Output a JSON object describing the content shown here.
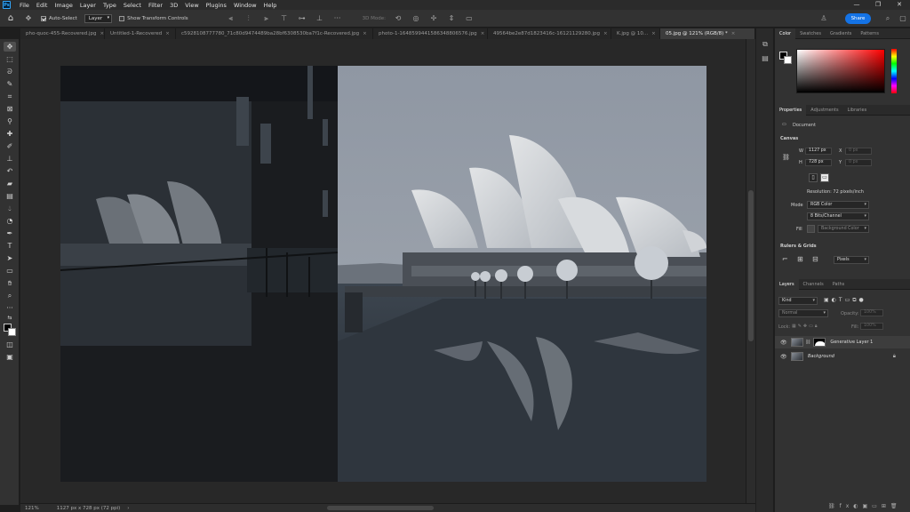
{
  "app": {
    "logo": "Ps",
    "window_controls": [
      "—",
      "❐",
      "✕"
    ]
  },
  "menu": [
    "File",
    "Edit",
    "Image",
    "Layer",
    "Type",
    "Select",
    "Filter",
    "3D",
    "View",
    "Plugins",
    "Window",
    "Help"
  ],
  "options_bar": {
    "auto_select_label": "Auto-Select",
    "auto_select_checked": true,
    "target_value": "Layer",
    "show_transform_label": "Show Transform Controls",
    "mode_3d_label": "3D Mode:",
    "share_label": "Share"
  },
  "tabs": [
    {
      "label": "pho-quoc-455-Recovered.jpg",
      "active": false
    },
    {
      "label": "Untitled-1-Recovered",
      "active": false
    },
    {
      "label": "c5928108777780_71c80d9474489ba28bf6308530ba7f1c-Recovered.jpg",
      "active": false
    },
    {
      "label": "photo-1-1648599441586348806576.jpg",
      "active": false
    },
    {
      "label": "49564be2e87d1823416c-16121129280.jpg",
      "active": false
    },
    {
      "label": "K.jpg @ 10...",
      "active": false
    },
    {
      "label": "05.jpg @ 121% (RGB/8) *",
      "active": true
    }
  ],
  "status": {
    "zoom": "121%",
    "doc_info": "1127 px x 728 px (72 ppi)"
  },
  "color_panel": {
    "tabs": [
      "Color",
      "Swatches",
      "Gradients",
      "Patterns"
    ],
    "active": "Color"
  },
  "properties_panel": {
    "tabs": [
      "Properties",
      "Adjustments",
      "Libraries"
    ],
    "active": "Properties",
    "doc_label": "Document",
    "canvas_title": "Canvas",
    "w_label": "W",
    "w_value": "1127 px",
    "h_label": "H",
    "h_value": "728 px",
    "x_label": "X",
    "x_value": "0 px",
    "y_label": "Y",
    "y_value": "0 px",
    "resolution": "Resolution: 72 pixels/inch",
    "mode_label": "Mode",
    "mode_value": "RGB Color",
    "depth_value": "8 Bits/Channel",
    "fill_label": "Fill",
    "fill_value": "Background Color",
    "rulers_title": "Rulers & Grids",
    "units_value": "Pixels"
  },
  "layers_panel": {
    "tabs": [
      "Layers",
      "Channels",
      "Paths"
    ],
    "active": "Layers",
    "kind_value": "Kind",
    "blend_value": "Normal",
    "opacity_label": "Opacity:",
    "opacity_value": "100%",
    "lock_label": "Lock:",
    "fill_label": "Fill:",
    "fill_value": "100%",
    "layers": [
      {
        "name": "Generative Layer 1",
        "italic": false
      },
      {
        "name": "Background",
        "italic": true
      }
    ]
  },
  "tools": [
    "move-tool",
    "marquee-tool",
    "lasso-tool",
    "quick-select-tool",
    "crop-tool",
    "frame-tool",
    "eyedropper-tool",
    "healing-tool",
    "brush-tool",
    "stamp-tool",
    "history-brush-tool",
    "eraser-tool",
    "gradient-tool",
    "blur-tool",
    "dodge-tool",
    "pen-tool",
    "type-tool",
    "path-select-tool",
    "rectangle-tool",
    "hand-tool",
    "zoom-tool",
    "more-tools"
  ]
}
